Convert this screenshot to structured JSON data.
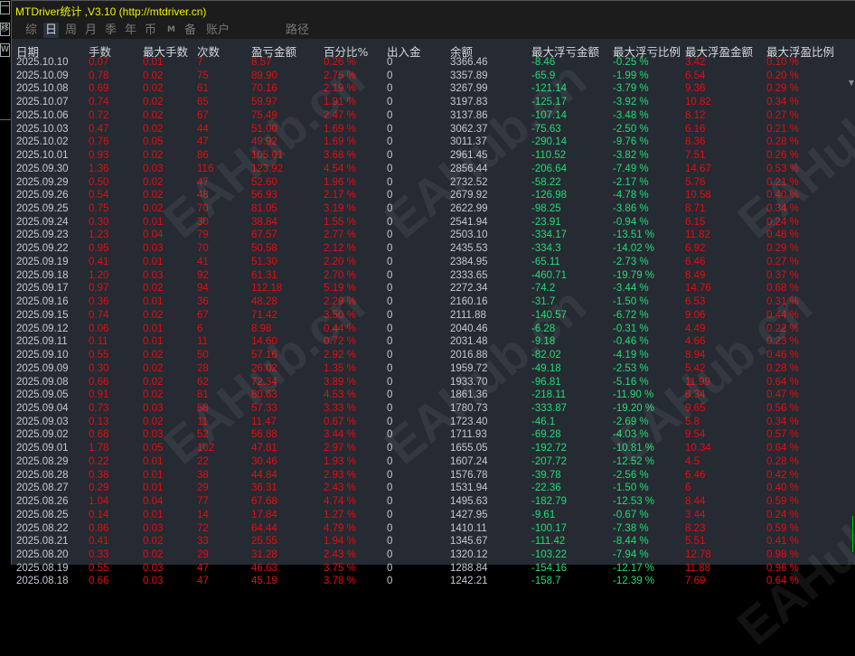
{
  "left_strip": {
    "buttons": [
      "一",
      "移",
      "W"
    ]
  },
  "window": {
    "title": "MTDriver统计 ,V3.10 (http://mtdriver.cn)"
  },
  "tabs": [
    "综",
    "日",
    "周",
    "月",
    "季",
    "年",
    "币",
    "M",
    "备",
    "账户",
    "路径"
  ],
  "selected_tab": "日",
  "watermark": "EAHub.cn",
  "colors": {
    "gray": "#c4c9d2",
    "red": "#e80c0c",
    "green": "#1ee06e",
    "title": "#f0f000"
  },
  "table": {
    "headers": [
      "日期",
      "手数",
      "最大手数",
      "次数",
      "盈亏金额",
      "百分比%",
      "出入金",
      "余额",
      "最大浮亏金额",
      "最大浮亏比例",
      "最大浮盈金额",
      "最大浮盈比例"
    ],
    "rows": [
      [
        "2025.10.10",
        "0.07",
        "0.01",
        "7",
        "8.57",
        "0.26 %",
        "0",
        "3366.46",
        "-8.46",
        "-0.25 %",
        "3.42",
        "0.10 %"
      ],
      [
        "2025.10.09",
        "0.78",
        "0.02",
        "75",
        "89.90",
        "2.75 %",
        "0",
        "3357.89",
        "-65.9",
        "-1.99 %",
        "6.54",
        "0.20 %"
      ],
      [
        "2025.10.08",
        "0.69",
        "0.02",
        "61",
        "70.16",
        "2.19 %",
        "0",
        "3267.99",
        "-121.14",
        "-3.79 %",
        "9.36",
        "0.29 %"
      ],
      [
        "2025.10.07",
        "0.74",
        "0.02",
        "65",
        "59.97",
        "1.91 %",
        "0",
        "3197.83",
        "-125.17",
        "-3.92 %",
        "10.82",
        "0.34 %"
      ],
      [
        "2025.10.06",
        "0.72",
        "0.02",
        "67",
        "75.49",
        "2.47 %",
        "0",
        "3137.86",
        "-107.14",
        "-3.48 %",
        "8.12",
        "0.27 %"
      ],
      [
        "2025.10.03",
        "0.47",
        "0.02",
        "44",
        "51.00",
        "1.69 %",
        "0",
        "3062.37",
        "-75.63",
        "-2.50 %",
        "6.16",
        "0.21 %"
      ],
      [
        "2025.10.02",
        "0.76",
        "0.05",
        "47",
        "49.92",
        "1.69 %",
        "0",
        "3011.37",
        "-290.14",
        "-9.76 %",
        "8.36",
        "0.28 %"
      ],
      [
        "2025.10.01",
        "0.93",
        "0.02",
        "86",
        "105.01",
        "3.68 %",
        "0",
        "2961.45",
        "-110.52",
        "-3.82 %",
        "7.51",
        "0.26 %"
      ],
      [
        "2025.09.30",
        "1.36",
        "0.03",
        "116",
        "123.92",
        "4.54 %",
        "0",
        "2856.44",
        "-206.64",
        "-7.49 %",
        "14.67",
        "0.53 %"
      ],
      [
        "2025.09.29",
        "0.50",
        "0.02",
        "47",
        "52.60",
        "1.96 %",
        "0",
        "2732.52",
        "-58.22",
        "-2.17 %",
        "5.76",
        "0.21 %"
      ],
      [
        "2025.09.26",
        "0.54",
        "0.02",
        "48",
        "56.93",
        "2.17 %",
        "0",
        "2679.92",
        "-126.98",
        "-4.78 %",
        "10.58",
        "0.40 %"
      ],
      [
        "2025.09.25",
        "0.75",
        "0.02",
        "70",
        "81.05",
        "3.19 %",
        "0",
        "2622.99",
        "-98.25",
        "-3.86 %",
        "8.71",
        "0.34 %"
      ],
      [
        "2025.09.24",
        "0.30",
        "0.01",
        "30",
        "38.84",
        "1.55 %",
        "0",
        "2541.94",
        "-23.91",
        "-0.94 %",
        "6.15",
        "0.24 %"
      ],
      [
        "2025.09.23",
        "1.23",
        "0.04",
        "79",
        "67.57",
        "2.77 %",
        "0",
        "2503.10",
        "-334.17",
        "-13.51 %",
        "11.82",
        "0.48 %"
      ],
      [
        "2025.09.22",
        "0.95",
        "0.03",
        "70",
        "50.58",
        "2.12 %",
        "0",
        "2435.53",
        "-334.3",
        "-14.02 %",
        "6.92",
        "0.29 %"
      ],
      [
        "2025.09.19",
        "0.41",
        "0.01",
        "41",
        "51.30",
        "2.20 %",
        "0",
        "2384.95",
        "-65.11",
        "-2.73 %",
        "6.46",
        "0.27 %"
      ],
      [
        "2025.09.18",
        "1.20",
        "0.03",
        "92",
        "61.31",
        "2.70 %",
        "0",
        "2333.65",
        "-460.71",
        "-19.79 %",
        "8.49",
        "0.37 %"
      ],
      [
        "2025.09.17",
        "0.97",
        "0.02",
        "94",
        "112.18",
        "5.19 %",
        "0",
        "2272.34",
        "-74.2",
        "-3.44 %",
        "14.76",
        "0.68 %"
      ],
      [
        "2025.09.16",
        "0.36",
        "0.01",
        "36",
        "48.28",
        "2.29 %",
        "0",
        "2160.16",
        "-31.7",
        "-1.50 %",
        "6.53",
        "0.31 %"
      ],
      [
        "2025.09.15",
        "0.74",
        "0.02",
        "67",
        "71.42",
        "3.50 %",
        "0",
        "2111.88",
        "-140.57",
        "-6.72 %",
        "9.06",
        "0.44 %"
      ],
      [
        "2025.09.12",
        "0.06",
        "0.01",
        "6",
        "8.98",
        "0.44 %",
        "0",
        "2040.46",
        "-6.28",
        "-0.31 %",
        "4.49",
        "0.22 %"
      ],
      [
        "2025.09.11",
        "0.11",
        "0.01",
        "11",
        "14.60",
        "0.72 %",
        "0",
        "2031.48",
        "-9.18",
        "-0.46 %",
        "4.66",
        "0.23 %"
      ],
      [
        "2025.09.10",
        "0.55",
        "0.02",
        "50",
        "57.16",
        "2.92 %",
        "0",
        "2016.88",
        "-82.02",
        "-4.19 %",
        "8.94",
        "0.46 %"
      ],
      [
        "2025.09.09",
        "0.30",
        "0.02",
        "28",
        "26.02",
        "1.35 %",
        "0",
        "1959.72",
        "-49.18",
        "-2.53 %",
        "5.42",
        "0.28 %"
      ],
      [
        "2025.09.08",
        "0.66",
        "0.02",
        "62",
        "72.34",
        "3.89 %",
        "0",
        "1933.70",
        "-96.81",
        "-5.16 %",
        "11.99",
        "0.64 %"
      ],
      [
        "2025.09.05",
        "0.91",
        "0.02",
        "81",
        "80.63",
        "4.53 %",
        "0",
        "1861.36",
        "-218.11",
        "-11.90 %",
        "8.34",
        "0.47 %"
      ],
      [
        "2025.09.04",
        "0.73",
        "0.03",
        "58",
        "57.33",
        "3.33 %",
        "0",
        "1780.73",
        "-333.87",
        "-19.20 %",
        "9.65",
        "0.56 %"
      ],
      [
        "2025.09.03",
        "0.13",
        "0.02",
        "11",
        "11.47",
        "0.67 %",
        "0",
        "1723.40",
        "-46.1",
        "-2.69 %",
        "5.8",
        "0.34 %"
      ],
      [
        "2025.09.02",
        "0.68",
        "0.03",
        "52",
        "56.88",
        "3.44 %",
        "0",
        "1711.93",
        "-69.28",
        "-4.03 %",
        "9.54",
        "0.57 %"
      ],
      [
        "2025.09.01",
        "1.78",
        "0.05",
        "102",
        "47.81",
        "2.97 %",
        "0",
        "1655.05",
        "-192.72",
        "-10.81 %",
        "10.34",
        "0.64 %"
      ],
      [
        "2025.08.29",
        "0.22",
        "0.01",
        "22",
        "30.46",
        "1.93 %",
        "0",
        "1607.24",
        "-207.72",
        "-12.52 %",
        "4.5",
        "0.28 %"
      ],
      [
        "2025.08.28",
        "0.38",
        "0.01",
        "38",
        "44.84",
        "2.93 %",
        "0",
        "1576.78",
        "-39.78",
        "-2.56 %",
        "6.46",
        "0.42 %"
      ],
      [
        "2025.08.27",
        "0.29",
        "0.01",
        "29",
        "36.31",
        "2.43 %",
        "0",
        "1531.94",
        "-22.36",
        "-1.50 %",
        "6",
        "0.40 %"
      ],
      [
        "2025.08.26",
        "1.04",
        "0.04",
        "77",
        "67.68",
        "4.74 %",
        "0",
        "1495.63",
        "-182.79",
        "-12.53 %",
        "8.44",
        "0.59 %"
      ],
      [
        "2025.08.25",
        "0.14",
        "0.01",
        "14",
        "17.84",
        "1.27 %",
        "0",
        "1427.95",
        "-9.61",
        "-0.67 %",
        "3.44",
        "0.24 %"
      ],
      [
        "2025.08.22",
        "0.86",
        "0.03",
        "72",
        "64.44",
        "4.79 %",
        "0",
        "1410.11",
        "-100.17",
        "-7.38 %",
        "8.23",
        "0.59 %"
      ],
      [
        "2025.08.21",
        "0.41",
        "0.02",
        "33",
        "25.55",
        "1.94 %",
        "0",
        "1345.67",
        "-111.42",
        "-8.44 %",
        "5.51",
        "0.41 %"
      ],
      [
        "2025.08.20",
        "0.33",
        "0.02",
        "29",
        "31.28",
        "2.43 %",
        "0",
        "1320.12",
        "-103.22",
        "-7.94 %",
        "12.78",
        "0.98 %"
      ],
      [
        "2025.08.19",
        "0.55",
        "0.03",
        "47",
        "46.63",
        "3.75 %",
        "0",
        "1288.84",
        "-154.16",
        "-12.17 %",
        "11.88",
        "0.96 %"
      ],
      [
        "2025.08.18",
        "0.66",
        "0.03",
        "47",
        "45.19",
        "3.78 %",
        "0",
        "1242.21",
        "-158.7",
        "-12.39 %",
        "7.69",
        "0.64 %"
      ]
    ]
  }
}
